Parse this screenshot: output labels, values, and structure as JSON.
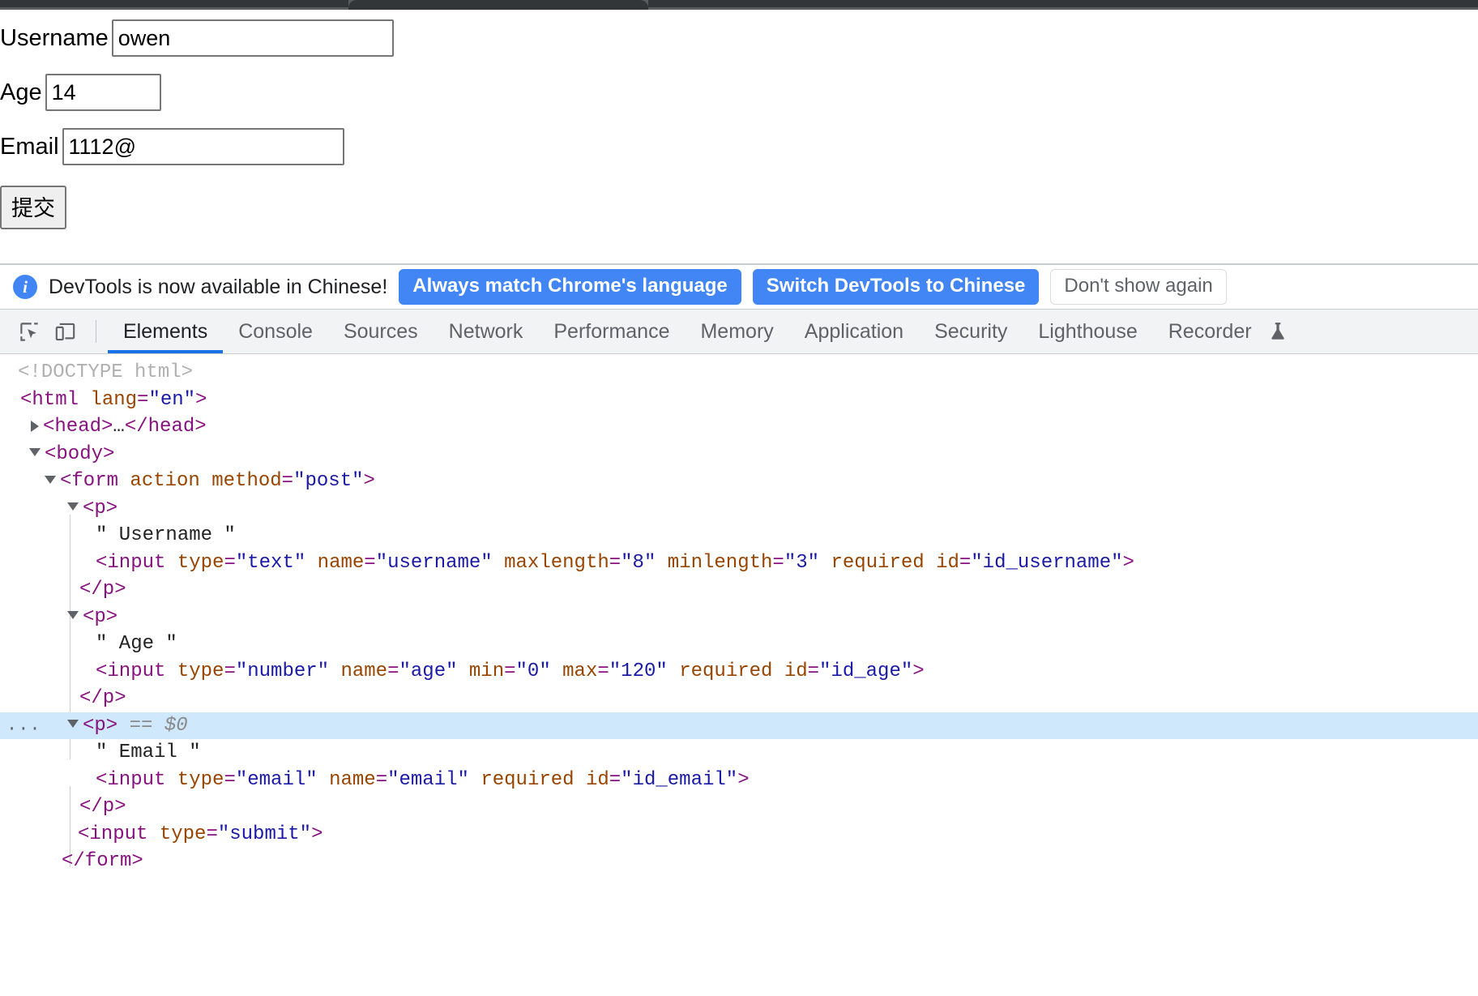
{
  "browser": {
    "tab_strip_visible": true
  },
  "webpage": {
    "form": {
      "fields": [
        {
          "label": "Username",
          "value": "owen",
          "name": "username-input"
        },
        {
          "label": "Age",
          "value": "14",
          "name": "age-input"
        },
        {
          "label": "Email",
          "value": "1112@",
          "name": "email-input"
        }
      ],
      "submit_label": "提交"
    }
  },
  "devtools": {
    "notification": {
      "icon": "info-icon",
      "message": "DevTools is now available in Chinese!",
      "buttons": [
        {
          "label": "Always match Chrome's language",
          "style": "primary"
        },
        {
          "label": "Switch DevTools to Chinese",
          "style": "primary"
        },
        {
          "label": "Don't show again",
          "style": "secondary"
        }
      ],
      "accent_color": "#4285f4"
    },
    "toolbar": {
      "inspect_icon": "inspect-element-icon",
      "device_icon": "device-toolbar-icon"
    },
    "tabs": [
      {
        "label": "Elements",
        "active": true
      },
      {
        "label": "Console",
        "active": false
      },
      {
        "label": "Sources",
        "active": false
      },
      {
        "label": "Network",
        "active": false
      },
      {
        "label": "Performance",
        "active": false
      },
      {
        "label": "Memory",
        "active": false
      },
      {
        "label": "Application",
        "active": false
      },
      {
        "label": "Security",
        "active": false
      },
      {
        "label": "Lighthouse",
        "active": false
      },
      {
        "label": "Recorder",
        "active": false
      }
    ],
    "active_tab_underline_color": "#1a73e8",
    "selected_row_color": "#cfe8fc",
    "dom_tree": {
      "lines": [
        {
          "id": "doctype",
          "text": "<!DOCTYPE html>"
        },
        {
          "id": "html-open",
          "text": "<html lang=\"en\">"
        },
        {
          "id": "head-collapsed",
          "text": "<head>…</head>"
        },
        {
          "id": "body-open",
          "text": "<body>"
        },
        {
          "id": "form-open",
          "text": "<form action method=\"post\">"
        },
        {
          "id": "p1-open",
          "text": "<p>"
        },
        {
          "id": "p1-text",
          "text": "\" Username \""
        },
        {
          "id": "input-username",
          "text": "<input type=\"text\" name=\"username\" maxlength=\"8\" minlength=\"3\" required id=\"id_username\">"
        },
        {
          "id": "p1-close",
          "text": "</p>"
        },
        {
          "id": "p2-open",
          "text": "<p>"
        },
        {
          "id": "p2-text",
          "text": "\" Age \""
        },
        {
          "id": "input-age",
          "text": "<input type=\"number\" name=\"age\" min=\"0\" max=\"120\" required id=\"id_age\">"
        },
        {
          "id": "p2-close",
          "text": "</p>"
        },
        {
          "id": "p3-open",
          "text": "<p>",
          "selected": true,
          "marker": "== $0",
          "dots": "..."
        },
        {
          "id": "p3-text",
          "text": "\" Email \""
        },
        {
          "id": "input-email",
          "text": "<input type=\"email\" name=\"email\" required id=\"id_email\">"
        },
        {
          "id": "p3-close",
          "text": "</p>"
        },
        {
          "id": "input-submit",
          "text": "<input type=\"submit\">"
        },
        {
          "id": "form-close",
          "text": "</form>"
        }
      ]
    }
  }
}
